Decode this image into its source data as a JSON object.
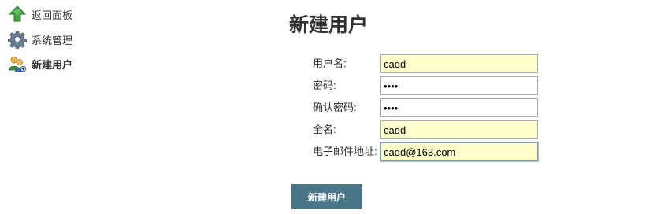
{
  "sidebar": {
    "items": [
      {
        "label": "返回面板",
        "icon": "up-arrow-icon"
      },
      {
        "label": "系统管理",
        "icon": "gear-icon"
      },
      {
        "label": "新建用户",
        "icon": "add-user-icon",
        "current": true
      }
    ]
  },
  "main": {
    "title": "新建用户",
    "fields": {
      "username": {
        "label": "用户名:",
        "value": "cadd"
      },
      "password": {
        "label": "密码:",
        "value": "••••"
      },
      "confirm_password": {
        "label": "确认密码:",
        "value": "••••"
      },
      "fullname": {
        "label": "全名:",
        "value": "cadd"
      },
      "email": {
        "label": "电子邮件地址:",
        "value": "cadd@163.com"
      }
    },
    "submit_label": "新建用户"
  },
  "colors": {
    "button_bg": "#4a7488",
    "autofill_bg": "#ffffcc",
    "arrow_icon": "#3fa13f",
    "gear_icon": "#6b7d92"
  }
}
